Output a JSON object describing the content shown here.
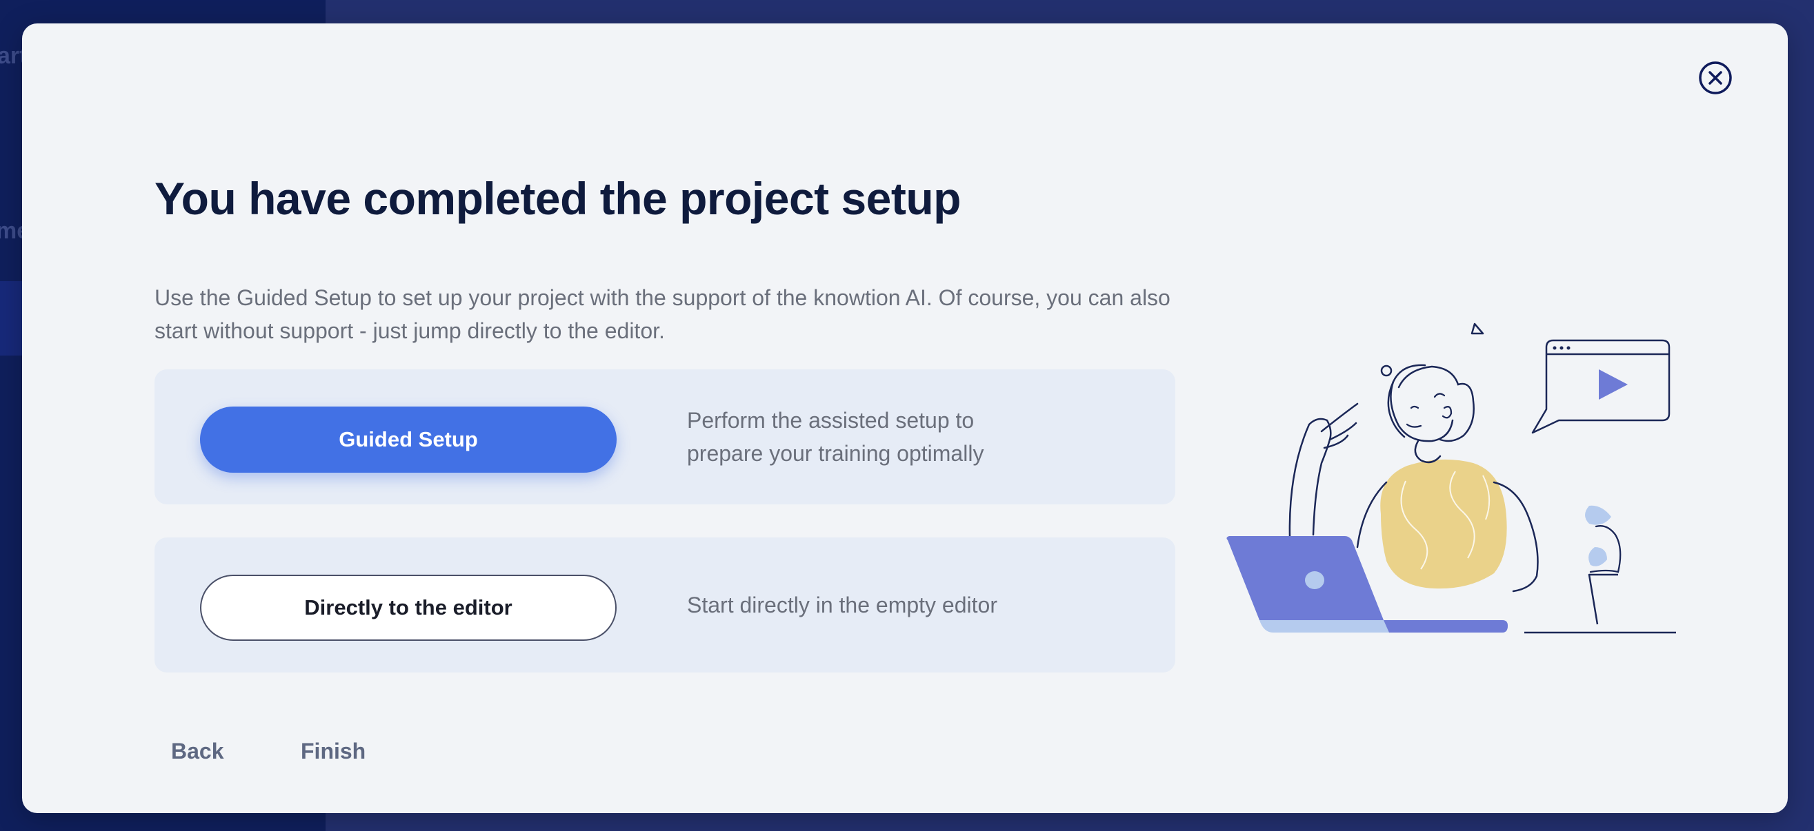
{
  "background": {
    "ghost_text_1": "art",
    "ghost_text_2": "me"
  },
  "modal": {
    "title": "You have completed the project setup",
    "intro": "Use the Guided Setup to set up your project with the support of the knowtion AI. Of course, you can also start without support - just jump directly to the editor.",
    "options": [
      {
        "button_label": "Guided Setup",
        "description_line1": "Perform the assisted setup to",
        "description_line2": "prepare your training optimally"
      },
      {
        "button_label": "Directly to the editor",
        "description": "Start directly in the empty editor"
      }
    ],
    "footer": {
      "back_label": "Back",
      "finish_label": "Finish"
    },
    "icons": {
      "close": "close-icon",
      "illustration": "person-with-laptop-illustration"
    }
  },
  "colors": {
    "primary": "#4271e5",
    "title": "#0f1b3d",
    "text_muted": "#6a6f7b",
    "card_bg": "#e6ecf6",
    "illustration_purple": "#6e7bd6",
    "illustration_yellow": "#ead28a",
    "illustration_light_blue": "#b5cbee"
  }
}
